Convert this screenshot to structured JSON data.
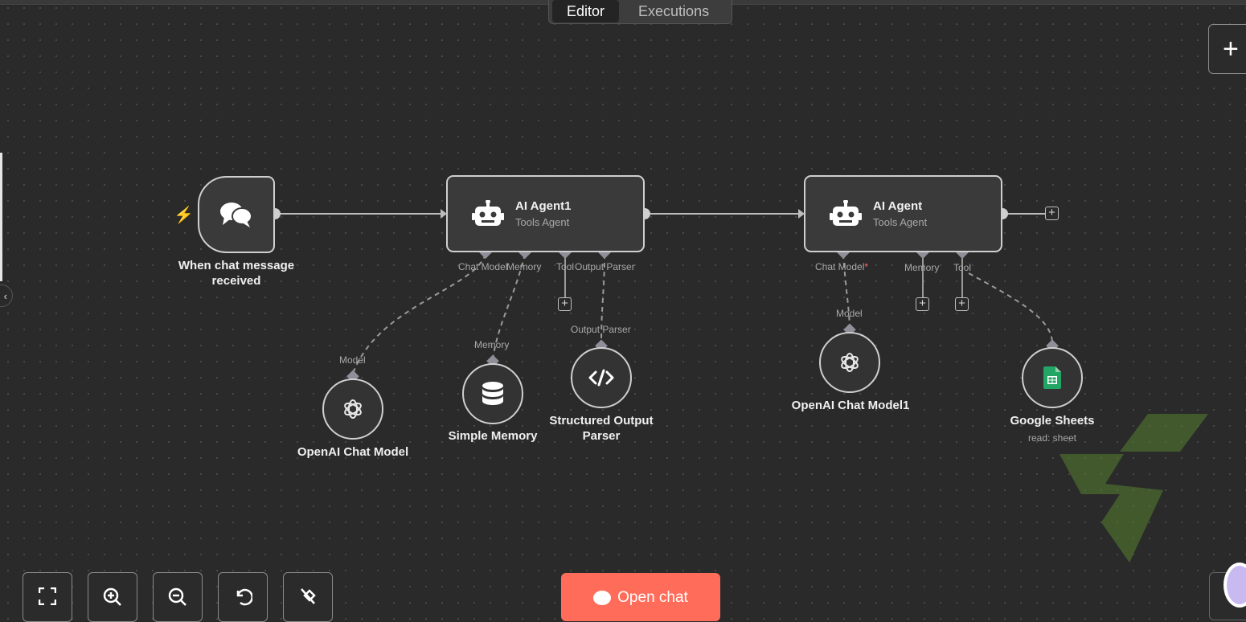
{
  "tabs": [
    {
      "label": "Editor",
      "active": true
    },
    {
      "label": "Executions",
      "active": false
    }
  ],
  "nodes": {
    "trigger": {
      "title": "When chat message received",
      "icon": "chat-bubbles-icon"
    },
    "agent1": {
      "title": "AI Agent1",
      "subtitle": "Tools Agent",
      "icon": "robot-icon",
      "ports": {
        "chat_model": "Chat Model",
        "memory": "Memory",
        "tool": "Tool",
        "output_parser": "Output Parser"
      }
    },
    "agent2": {
      "title": "AI Agent",
      "subtitle": "Tools Agent",
      "icon": "robot-icon",
      "ports": {
        "chat_model": "Chat Model",
        "chat_model_required": "*",
        "memory": "Memory",
        "tool": "Tool"
      }
    },
    "openai1": {
      "title": "OpenAI Chat Model",
      "port": "Model",
      "icon": "openai-icon"
    },
    "memory": {
      "title": "Simple Memory",
      "port": "Memory",
      "icon": "database-icon"
    },
    "parser": {
      "title": "Structured Output Parser",
      "port": "Output Parser",
      "icon": "code-icon"
    },
    "openai2": {
      "title": "OpenAI Chat Model1",
      "port": "Model",
      "icon": "openai-icon"
    },
    "sheets": {
      "title": "Google Sheets",
      "subtitle": "read: sheet",
      "icon": "google-sheets-icon"
    }
  },
  "controls": {
    "open_chat_label": "Open chat",
    "buttons": [
      "fit-view-icon",
      "zoom-in-icon",
      "zoom-out-icon",
      "reset-zoom-icon",
      "tidy-up-icon"
    ]
  },
  "colors": {
    "accent": "#ff6d5a",
    "canvas": "#2a2a2a",
    "node_border": "#cfcfcf",
    "sheets_green": "#23a566",
    "watermark": "#4a6b2a"
  }
}
